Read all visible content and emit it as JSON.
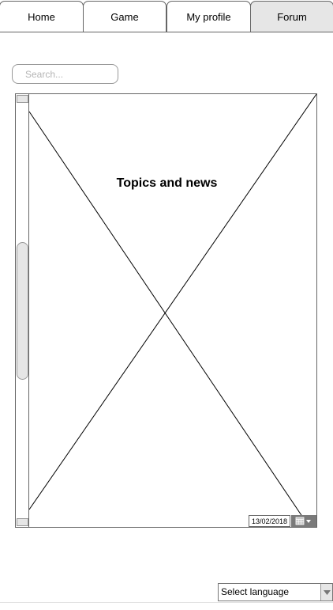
{
  "tabs": {
    "home": "Home",
    "game": "Game",
    "profile": "My profile",
    "forum": "Forum",
    "active": "Forum"
  },
  "search": {
    "placeholder": "Search...",
    "value": ""
  },
  "content": {
    "title": "Topics and news",
    "date": "13/02/2018",
    "calendar_icon": "calendar-icon"
  },
  "footer": {
    "language_select_label": "Select language",
    "language_arrow_icon": "chevron-down-icon"
  },
  "colors": {
    "border": "#666666",
    "active_tab": "#e6e6e6",
    "placeholder": "#b5b5b5",
    "date_button": "#7a7a7a"
  }
}
